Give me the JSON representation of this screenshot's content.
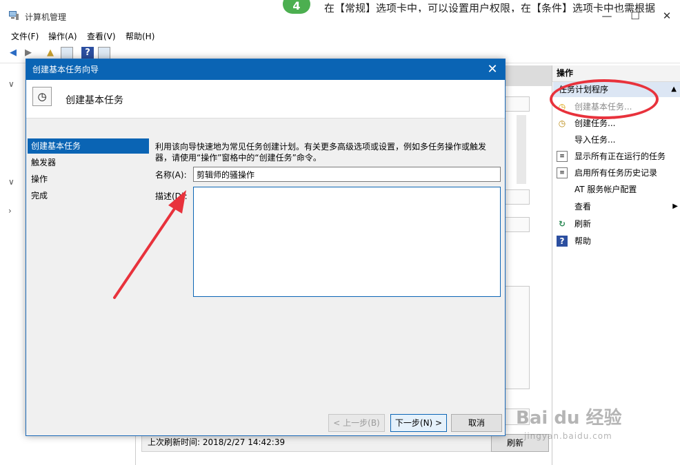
{
  "window": {
    "title": "计算机管理",
    "background_text": "在【常规】选项卡中，可以设置用户权限，在【条件】选项卡中也需根据"
  },
  "step_badge": "4",
  "menu": [
    "文件(F)",
    "操作(A)",
    "查看(V)",
    "帮助(H)"
  ],
  "dialog": {
    "title": "创建基本任务向导",
    "header_title": "创建基本任务",
    "nav_steps": [
      "创建基本任务",
      "触发器",
      "操作",
      "完成"
    ],
    "active_step": 0,
    "description": "利用该向导快速地为常见任务创建计划。有关更多高级选项或设置，例如多任务操作或触发器，请使用“操作”窗格中的“创建任务”命令。",
    "name_label": "名称(A):",
    "name_value": "剪辑师的骚操作",
    "desc_label": "描述(D):",
    "buttons": {
      "back": "< 上一步(B)",
      "next": "下一步(N) >",
      "cancel": "取消"
    }
  },
  "center": {
    "status_text": "上次刷新时间: 2018/2/27 14:42:39",
    "refresh_button": "刷新"
  },
  "actions": {
    "header": "操作",
    "section": "任务计划程序",
    "items": [
      {
        "label": "创建基本任务...",
        "icon": "clock-star-icon",
        "disabled": true
      },
      {
        "label": "创建任务...",
        "icon": "clock-icon"
      },
      {
        "label": "导入任务...",
        "icon": ""
      },
      {
        "label": "显示所有正在运行的任务",
        "icon": "list-icon"
      },
      {
        "label": "启用所有任务历史记录",
        "icon": "history-icon"
      },
      {
        "label": "AT 服务帐户配置",
        "icon": ""
      },
      {
        "label": "查看",
        "icon": "",
        "submenu": true
      },
      {
        "label": "刷新",
        "icon": "refresh-icon"
      },
      {
        "label": "帮助",
        "icon": "help-icon"
      }
    ]
  },
  "watermark": {
    "brand": "Bai du 经验",
    "url": "jingyan.baidu.com"
  },
  "colors": {
    "accent_blue": "#0a64b4",
    "highlight_red": "#e8323c",
    "section_bg": "#dce6f4"
  }
}
